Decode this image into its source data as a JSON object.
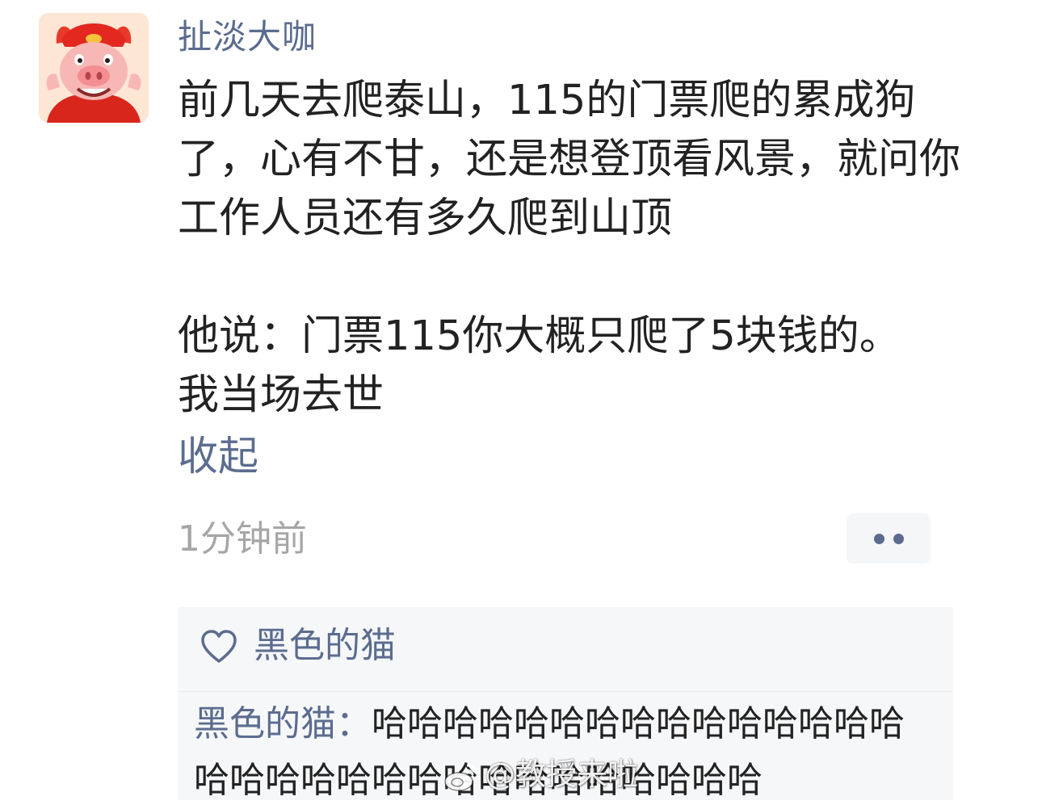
{
  "post": {
    "author": "扯淡大咖",
    "paragraphs": [
      "前几天去爬泰山，115的门票爬的累成狗了，心有不甘，还是想登顶看风景，就问你工作人员还有多久爬到山顶",
      "他说：门票115你大概只爬了5块钱的。\n我当场去世"
    ],
    "collapse_label": "收起",
    "timestamp": "1分钟前",
    "more_icon": "more-dots-icon"
  },
  "likes": {
    "icon": "heart-outline-icon",
    "user": "黑色的猫"
  },
  "comment": {
    "author": "黑色的猫：",
    "text": "哈哈哈哈哈哈哈哈哈哈哈哈哈哈哈哈哈哈哈哈哈哈哈哈哈哈哈哈哈哈哈"
  },
  "watermark": {
    "text": "@教授来啦",
    "icon": "weibo-logo-icon"
  },
  "colors": {
    "link": "#5b6c8f",
    "text": "#222222",
    "timestamp": "#a6a6a6",
    "panel": "#f6f7f9"
  }
}
